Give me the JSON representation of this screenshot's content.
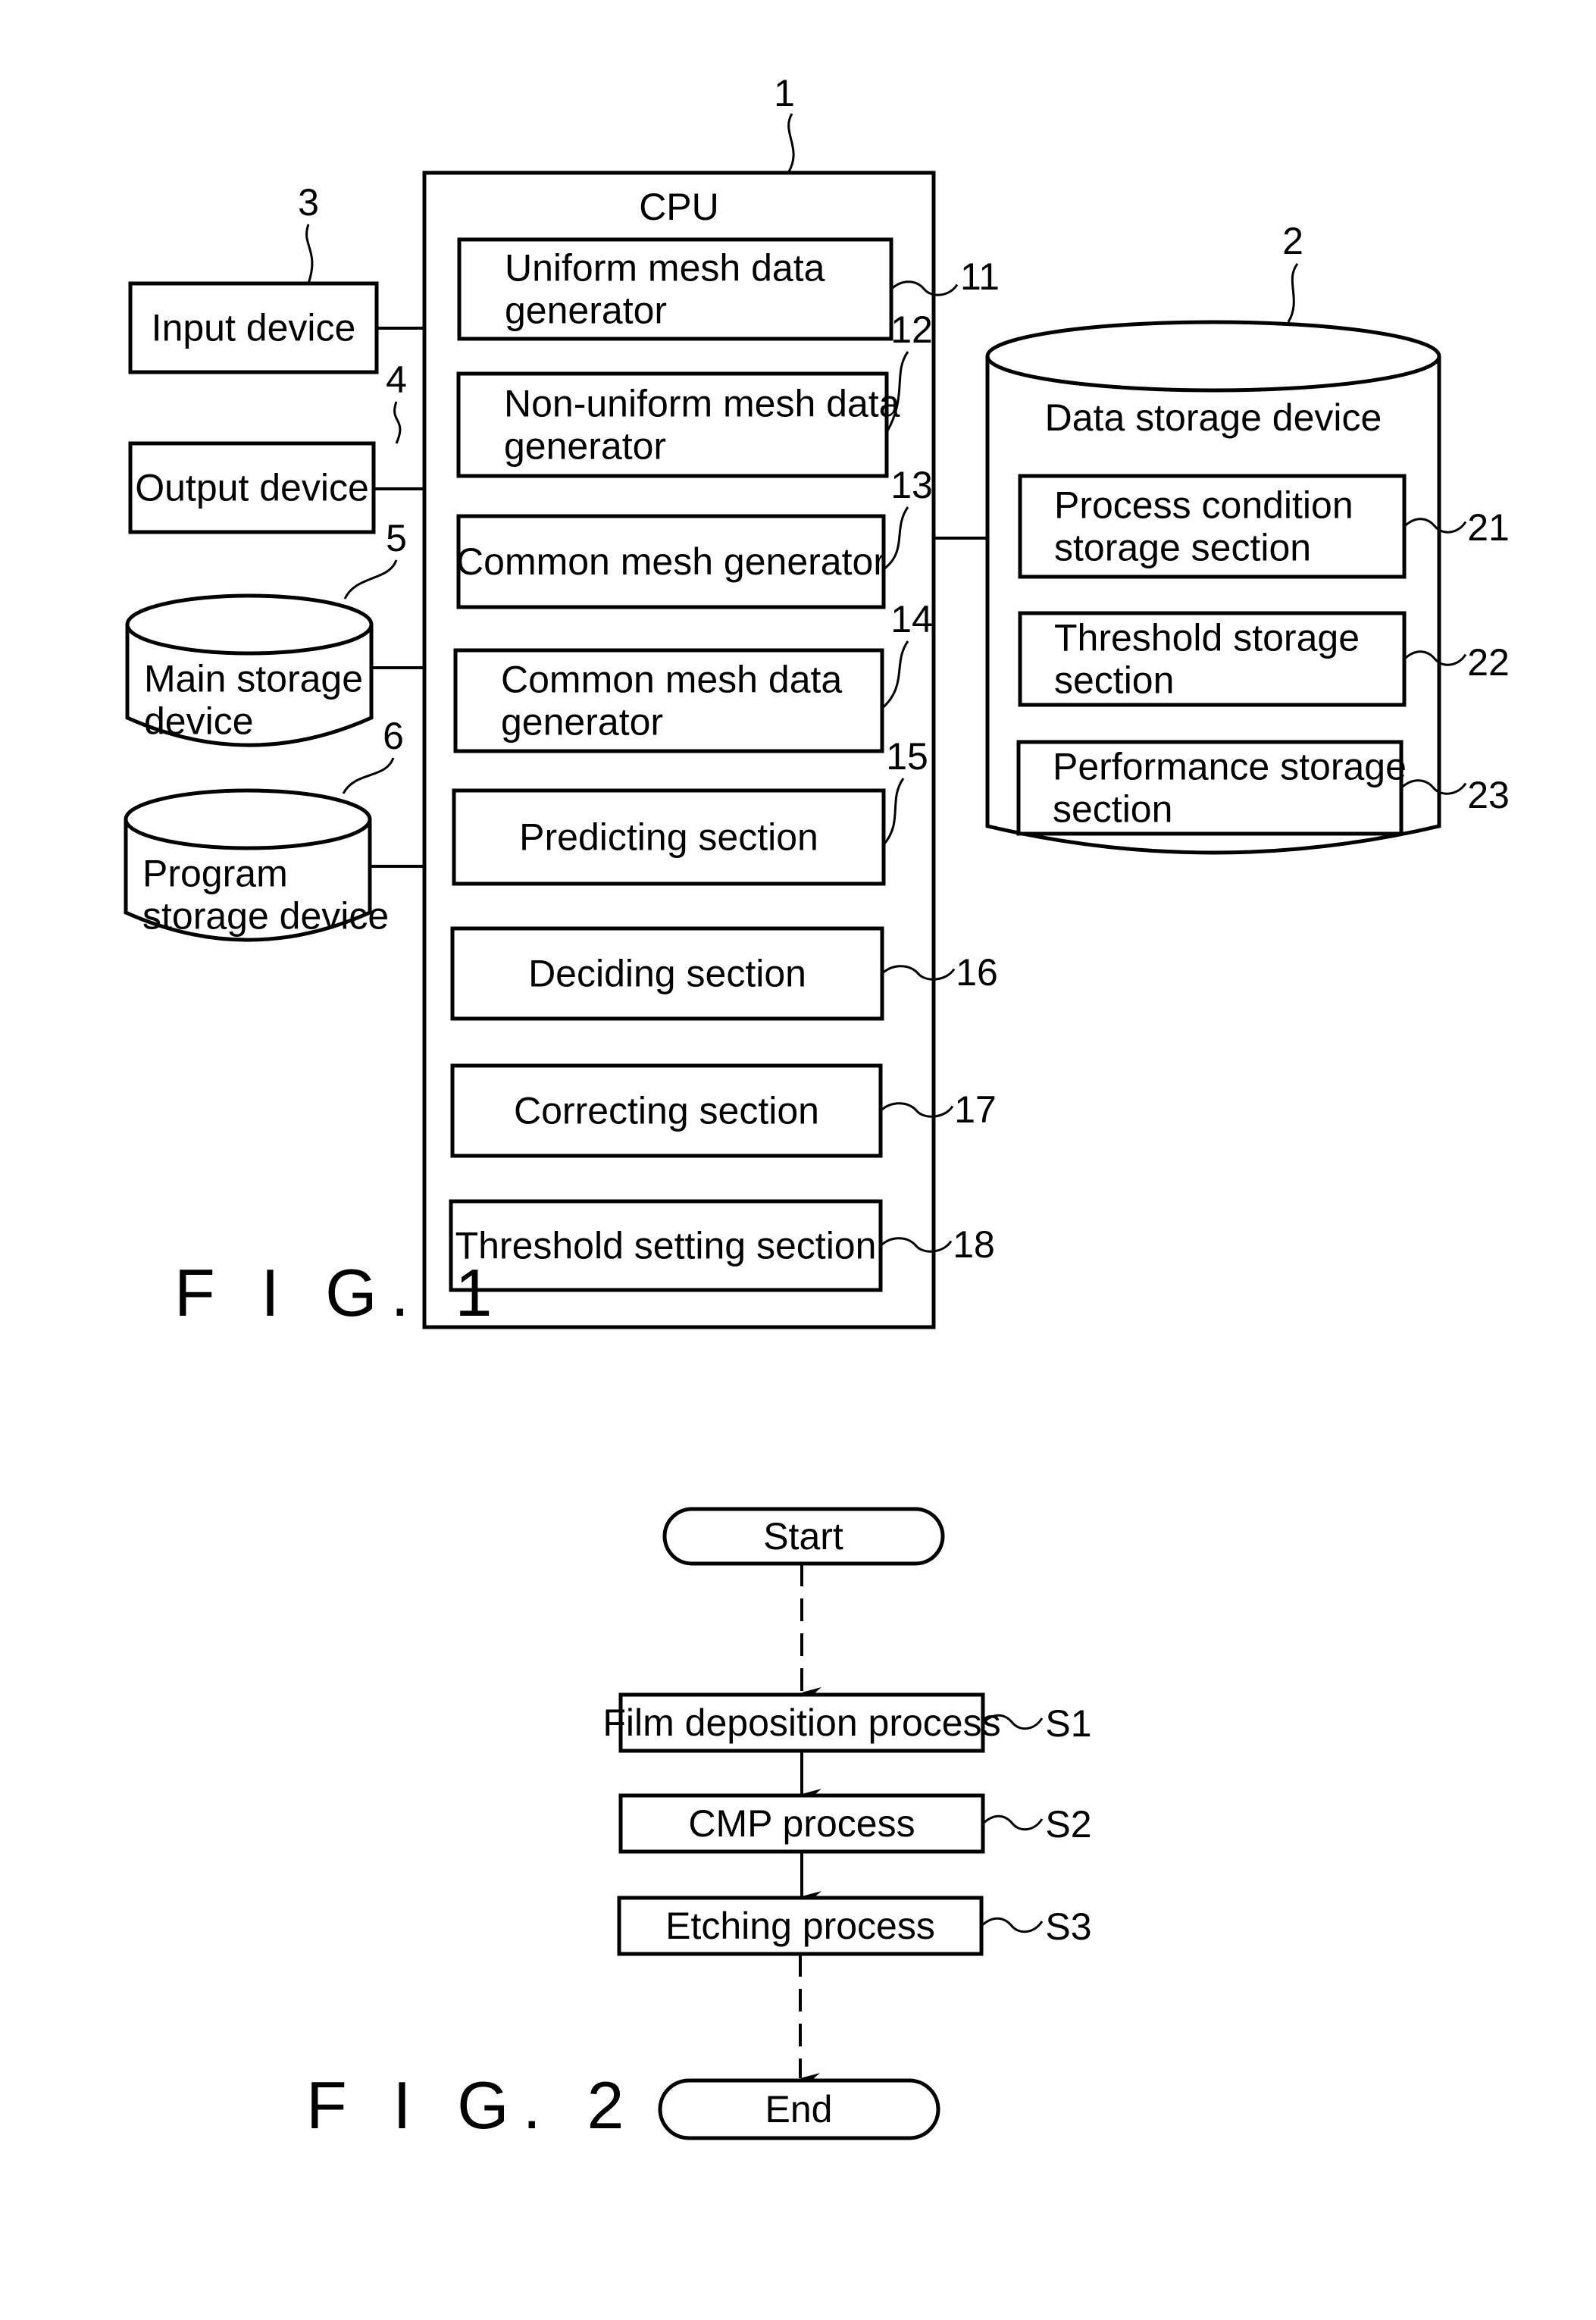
{
  "figure1": {
    "caption": "F I G. 1",
    "cpu": {
      "ref": "1",
      "title": "CPU",
      "modules": [
        {
          "ref": "11",
          "lines": [
            "Uniform mesh data",
            "generator"
          ]
        },
        {
          "ref": "12",
          "lines": [
            "Non-uniform mesh data",
            "generator"
          ]
        },
        {
          "ref": "13",
          "lines": [
            "Common mesh generator"
          ]
        },
        {
          "ref": "14",
          "lines": [
            "Common mesh data",
            "generator"
          ]
        },
        {
          "ref": "15",
          "lines": [
            "Predicting section"
          ]
        },
        {
          "ref": "16",
          "lines": [
            "Deciding section"
          ]
        },
        {
          "ref": "17",
          "lines": [
            "Correcting section"
          ]
        },
        {
          "ref": "18",
          "lines": [
            "Threshold setting section"
          ]
        }
      ]
    },
    "peripherals": [
      {
        "ref": "3",
        "shape": "box",
        "lines": [
          "Input device"
        ]
      },
      {
        "ref": "4",
        "shape": "box",
        "lines": [
          "Output device"
        ]
      },
      {
        "ref": "5",
        "shape": "cylinder",
        "lines": [
          "Main storage",
          "device"
        ]
      },
      {
        "ref": "6",
        "shape": "cylinder",
        "lines": [
          "Program",
          "storage device"
        ]
      }
    ],
    "data_storage": {
      "ref": "2",
      "title": "Data storage device",
      "sections": [
        {
          "ref": "21",
          "lines": [
            "Process condition",
            "storage section"
          ]
        },
        {
          "ref": "22",
          "lines": [
            "Threshold storage",
            "section"
          ]
        },
        {
          "ref": "23",
          "lines": [
            "Performance storage",
            "section"
          ]
        }
      ]
    }
  },
  "figure2": {
    "caption": "F I G. 2",
    "start": "Start",
    "end": "End",
    "steps": [
      {
        "ref": "S1",
        "label": "Film deposition process"
      },
      {
        "ref": "S2",
        "label": "CMP process"
      },
      {
        "ref": "S3",
        "label": "Etching process"
      }
    ]
  }
}
